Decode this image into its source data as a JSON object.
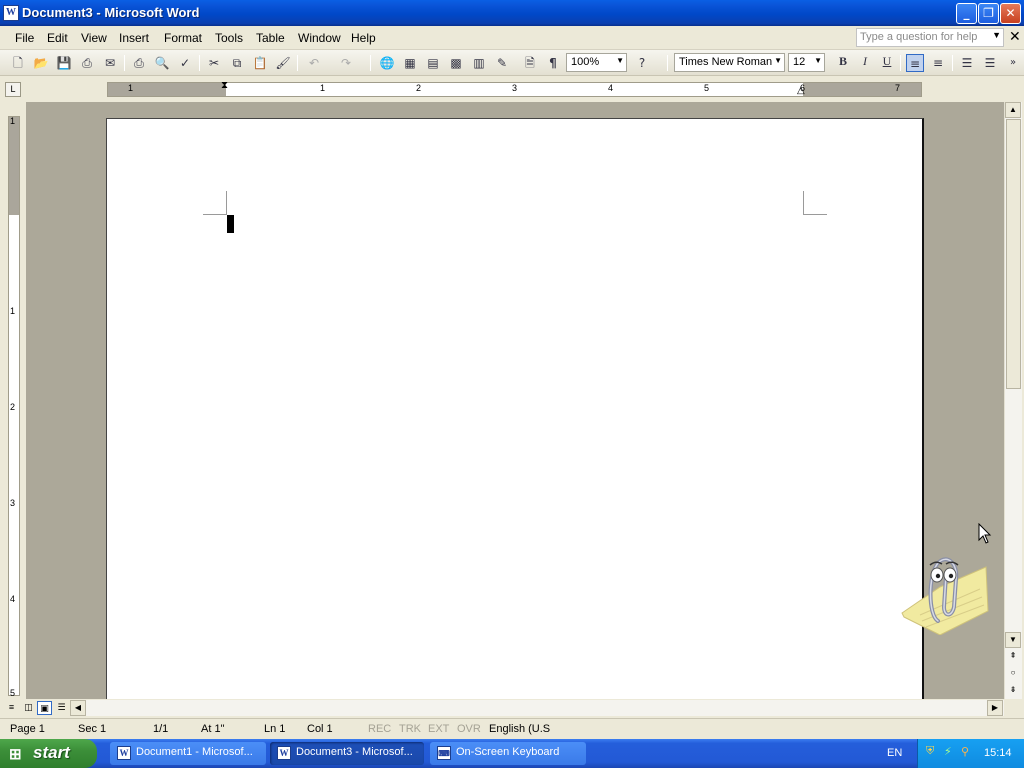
{
  "window": {
    "title": "Document3 - Microsoft Word",
    "icon": "word-icon"
  },
  "menu": [
    "File",
    "Edit",
    "View",
    "Insert",
    "Format",
    "Tools",
    "Table",
    "Window",
    "Help"
  ],
  "help_box": {
    "placeholder": "Type a question for help"
  },
  "toolbar": {
    "zoom": "100%",
    "font": "Times New Roman",
    "font_size": "12",
    "bold": "B",
    "italic": "I",
    "underline": "U",
    "pilcrow": "¶"
  },
  "ruler": {
    "horizontal_numbers": [
      "1",
      "1",
      "2",
      "3",
      "4",
      "5",
      "6",
      "7"
    ],
    "vertical_numbers": [
      "1",
      "1",
      "2",
      "3",
      "4",
      "5"
    ]
  },
  "status": {
    "page": "Page  1",
    "section": "Sec  1",
    "pages": "1/1",
    "at": "At  1\"",
    "line": "Ln  1",
    "column": "Col  1",
    "rec": "REC",
    "trk": "TRK",
    "ext": "EXT",
    "ovr": "OVR",
    "language": "English (U.S"
  },
  "taskbar": {
    "start": "start",
    "tasks": [
      {
        "label": "Document1 - Microsof...",
        "icon": "word-icon",
        "active": false
      },
      {
        "label": "Document3 - Microsof...",
        "icon": "word-icon",
        "active": true
      },
      {
        "label": "On-Screen Keyboard",
        "icon": "keyboard-icon",
        "active": false
      }
    ],
    "language": "EN",
    "clock": "15:14"
  },
  "colors": {
    "titlebar": "#0a54d8",
    "taskbar": "#245edb",
    "start": "#3c8f39",
    "workspace": "#aca899"
  }
}
